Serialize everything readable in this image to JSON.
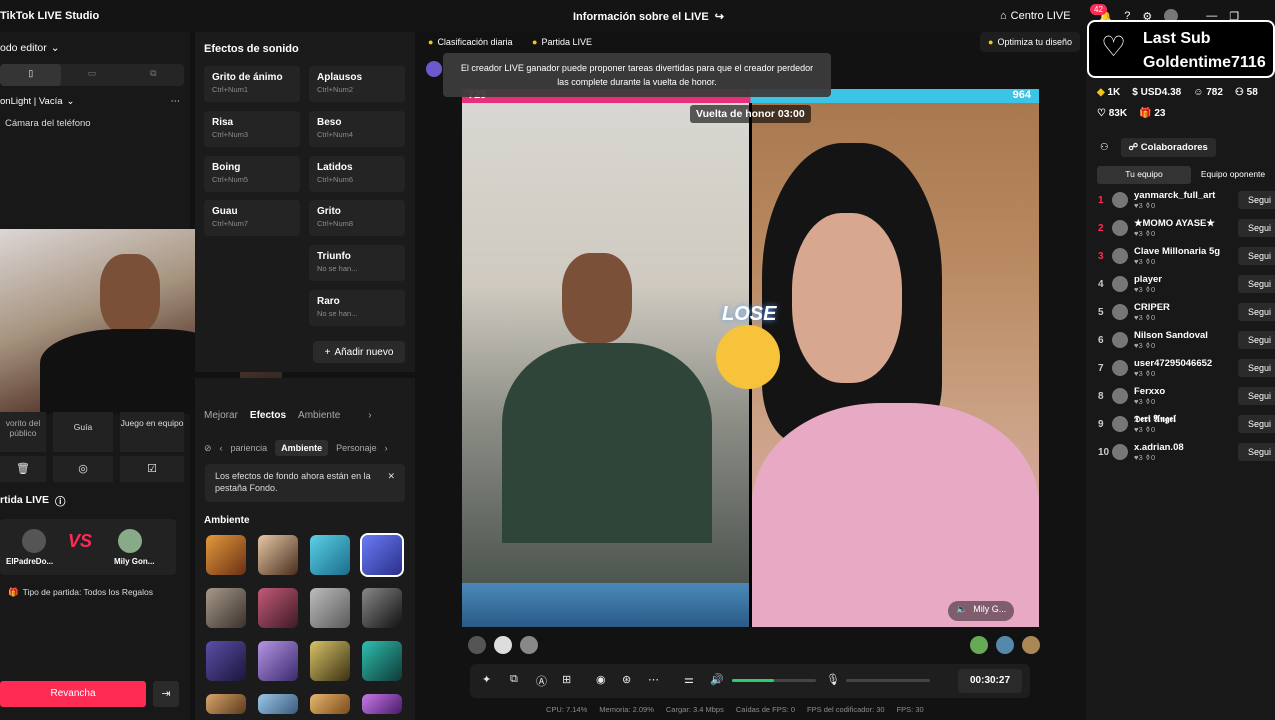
{
  "app": {
    "title": "TikTok LIVE Studio"
  },
  "header": {
    "info_label": "Información sobre el LIVE",
    "centro_label": "Centro LIVE",
    "notif_count": "42"
  },
  "left": {
    "mode_label": "odo editor",
    "scene_label": "onLight | Vacía",
    "source_label": "Cámara del teléfono",
    "tools": [
      "vorito del público",
      "Guía",
      "Juego en equipo"
    ],
    "match_title": "rtida LIVE",
    "player1": "ElPadreDo...",
    "player2": "Mily Gon...",
    "match_type": "Tipo de partida: Todos los Regalos",
    "rematch": "Revancha"
  },
  "sfx": {
    "title": "Efectos de sonido",
    "buttons": [
      {
        "name": "Grito de ánimo",
        "key": "Ctrl+Num1"
      },
      {
        "name": "Aplausos",
        "key": "Ctrl+Num2"
      },
      {
        "name": "Risa",
        "key": "Ctrl+Num3"
      },
      {
        "name": "Beso",
        "key": "Ctrl+Num4"
      },
      {
        "name": "Boing",
        "key": "Ctrl+Num5"
      },
      {
        "name": "Latidos",
        "key": "Ctrl+Num6"
      },
      {
        "name": "Guau",
        "key": "Ctrl+Num7"
      },
      {
        "name": "Grito",
        "key": "Ctrl+Num8"
      },
      {
        "name": "Triunfo",
        "key": "No se han..."
      },
      {
        "name": "Raro",
        "key": "No se han..."
      }
    ],
    "add_label": "Añadir nuevo"
  },
  "effects": {
    "tabs": [
      "Mejorar",
      "Efectos",
      "Ambiente"
    ],
    "subtabs": [
      "pariencia",
      "Ambiente",
      "Personaje"
    ],
    "notice": "Los efectos de fondo ahora están en la pestaña Fondo.",
    "section": "Ambiente"
  },
  "stage": {
    "daily_rank": "Clasificación diaria",
    "live_match": "Partida LIVE",
    "optimize": "Optimiza tu diseño",
    "banner": "El creador LIVE ganador puede proponer tareas divertidas para que el creador perdedor las complete durante la vuelta de honor.",
    "honor_lap": "Vuelta de honor 03:00",
    "score_left": "729",
    "score_right": "964",
    "lose_label": "LOSE",
    "right_name": "Mily G...",
    "timer": "00:30:27"
  },
  "stats": {
    "cpu": "CPU: 7.14%",
    "mem": "Memoria: 2.09%",
    "load": "Cargar: 3.4 Mbps",
    "fps_drop": "Caídas de FPS: 0",
    "fps_enc": "FPS del codificador: 30",
    "fps": "FPS: 30"
  },
  "right": {
    "lastsub_l1": "Last Sub",
    "lastsub_l2": "Goldentime7116",
    "diamonds": "1K",
    "usd": "USD4.38",
    "viewers": "782",
    "followers": "58",
    "likes": "83K",
    "gifts": "23",
    "collab": "Colaboradores",
    "team_tab": "Tu equipo",
    "opp_tab": "Equipo oponente",
    "follow_label": "Segui",
    "viewers_list": [
      {
        "rank": "1",
        "name": "yanmarck_full_art",
        "meta": "♥3  ⚱0"
      },
      {
        "rank": "2",
        "name": "★MOMO AYASE★",
        "meta": "♥3  ⚱0"
      },
      {
        "rank": "3",
        "name": "Clave Millonaria 5g",
        "meta": "♥3  ⚱0"
      },
      {
        "rank": "4",
        "name": "player",
        "meta": "♥3  ⚱0"
      },
      {
        "rank": "5",
        "name": "CRIPER",
        "meta": "♥3  ⚱0"
      },
      {
        "rank": "6",
        "name": "Nilson Sandoval",
        "meta": "♥3  ⚱0"
      },
      {
        "rank": "7",
        "name": "user47295046652",
        "meta": "♥3  ⚱0"
      },
      {
        "rank": "8",
        "name": "Ferxxo",
        "meta": "♥3  ⚱0"
      },
      {
        "rank": "9",
        "name": "𝕯𝖊𝖗𝖎 𝕬𝖓𝖌𝖊𝖑",
        "meta": "♥3  ⚱0"
      },
      {
        "rank": "10",
        "name": "x.adrian.08",
        "meta": "♥3  ⚱0"
      }
    ]
  },
  "colors": {
    "accent": "#fe2c55",
    "blue": "#3bc4e6",
    "pink": "#e8307a",
    "green": "#2ecc71"
  }
}
